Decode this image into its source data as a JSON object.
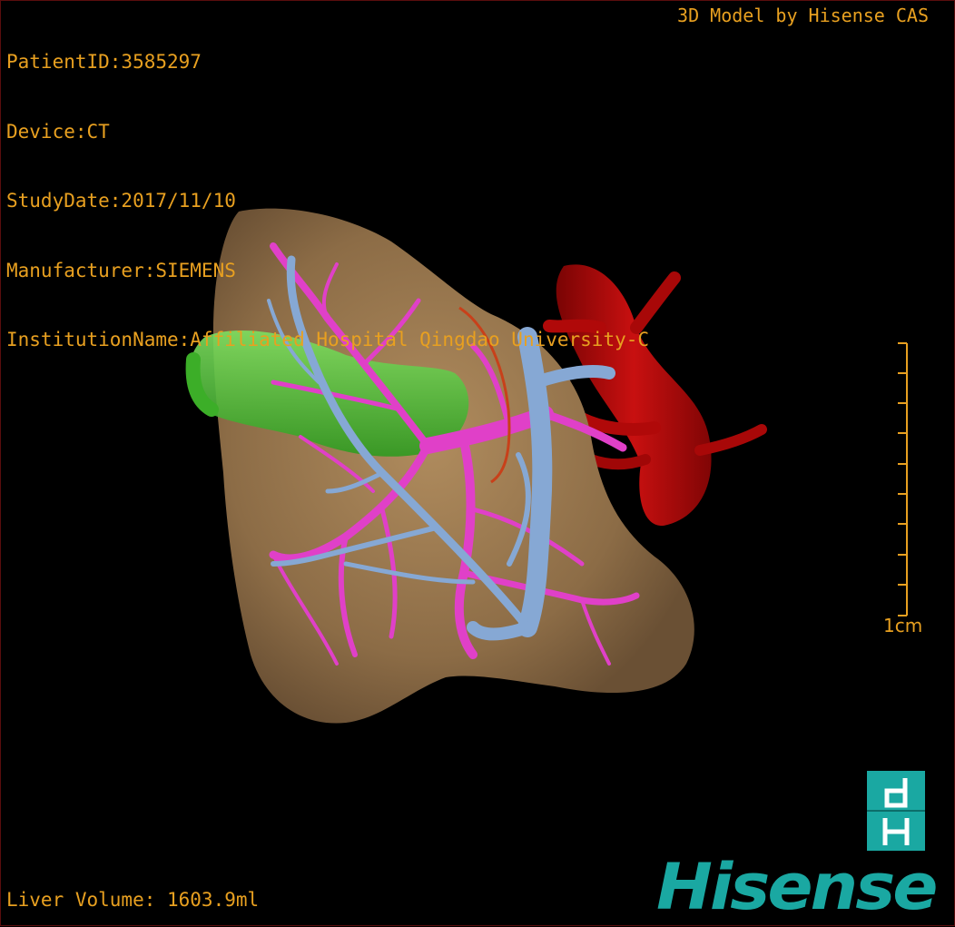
{
  "overlay": {
    "patient_id": "PatientID:3585297",
    "device": "Device:CT",
    "study_date": "StudyDate:2017/11/10",
    "manufacturer": "Manufacturer:SIEMENS",
    "institution": "InstitutionName:Affiliated Hospital Qingdao University-C",
    "credit": "3D Model by Hisense CAS"
  },
  "measurement": {
    "liver_volume": "Liver Volume: 1603.9ml"
  },
  "scale_bar": {
    "label": "1cm"
  },
  "branding": {
    "logo_text": "Hisense",
    "logo_icon": "dh-logo-icon"
  },
  "colors": {
    "text": "#e8a020",
    "liver": "#9c7b52",
    "portal_vein": "#e040c8",
    "hepatic_vein": "#86a8d4",
    "aorta": "#b80a0a",
    "gallbladder": "#46c030",
    "brand": "#1aa8a2"
  }
}
